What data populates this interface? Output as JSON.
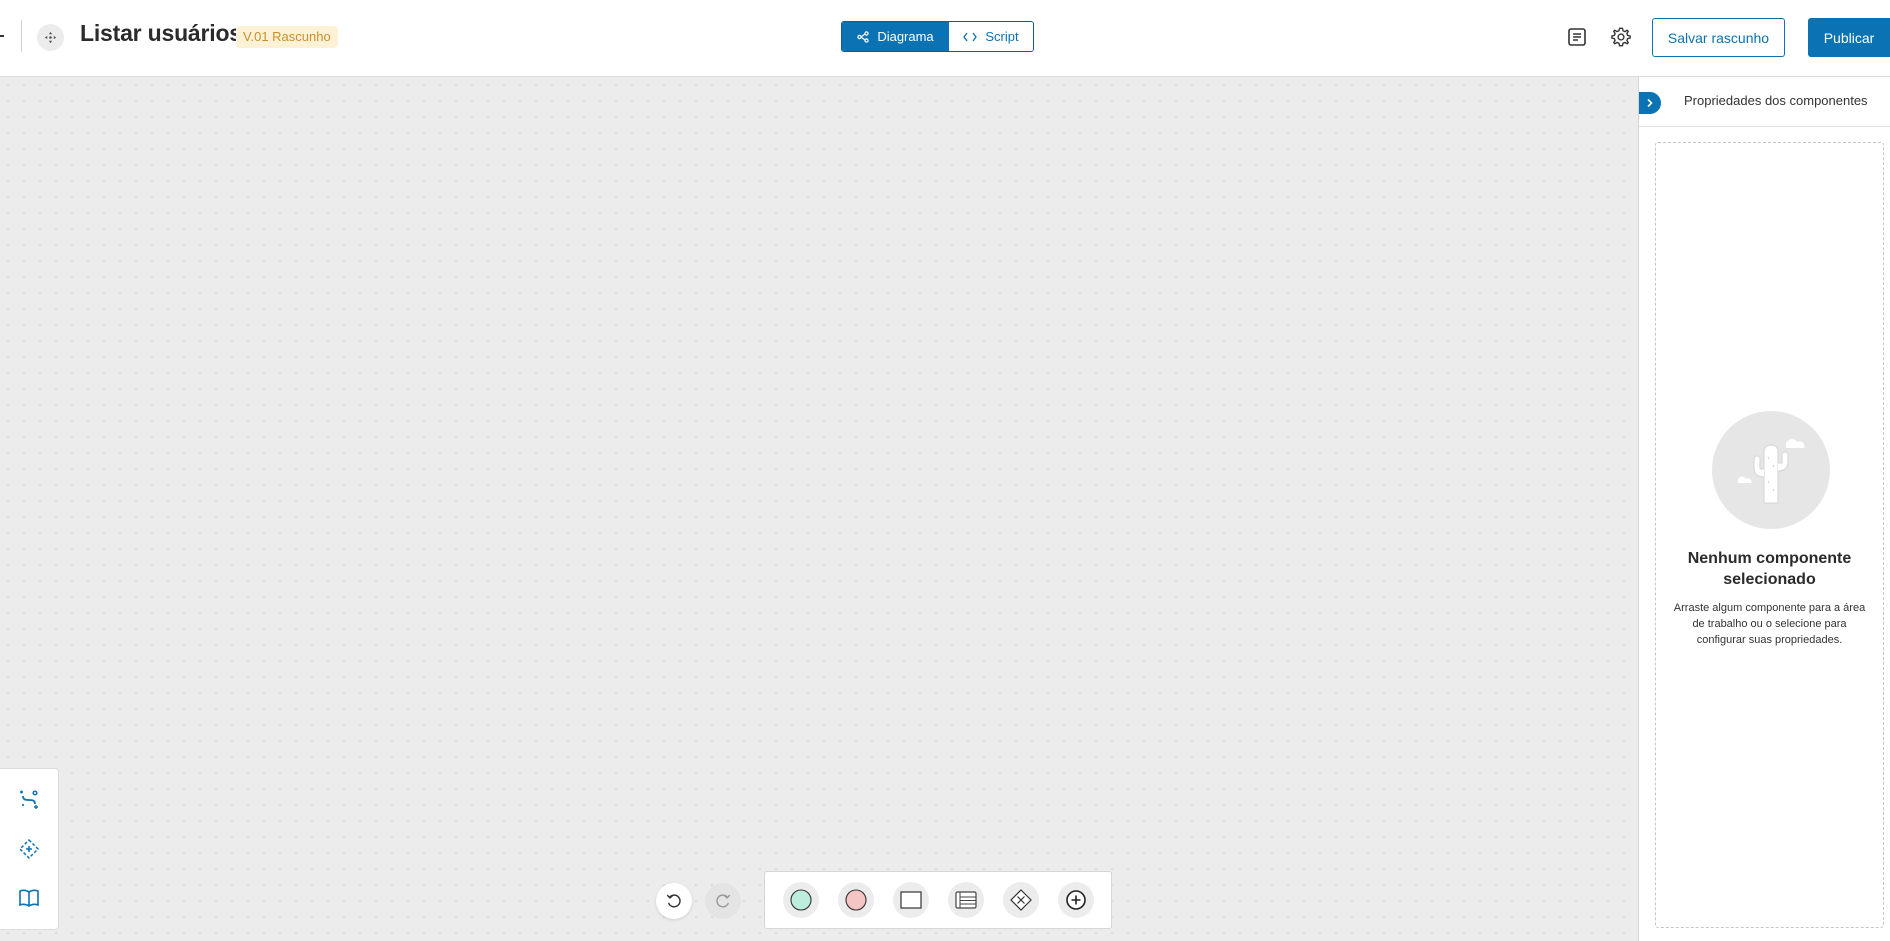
{
  "header": {
    "title": "Listar usuários",
    "version_badge": "V.01 Rascunho",
    "view_toggle": {
      "diagram_label": "Diagrama",
      "script_label": "Script",
      "selected": "Diagrama"
    },
    "save_draft_label": "Salvar rascunho",
    "publish_label": "Publicar",
    "icons": [
      "flow-icon",
      "document-list-icon",
      "gear-icon"
    ]
  },
  "canvas": {
    "background": "#ececec",
    "side_toolbar": [
      "auto-connect-icon",
      "recenter-icon",
      "book-icon"
    ],
    "history": [
      "undo-icon",
      "redo-icon"
    ],
    "palette": [
      "start-node-icon",
      "end-node-icon",
      "task-node-icon",
      "list-node-icon",
      "decision-node-icon",
      "add-node-icon"
    ]
  },
  "panel": {
    "title": "Propriedades dos componentes",
    "empty_title": "Nenhum componente selecionado",
    "empty_desc": "Arraste algum componente para a área de trabalho ou o selecione para configurar suas propriedades."
  },
  "colors": {
    "accent": "#0b73b3",
    "badge_bg": "#fdf1d6",
    "badge_text": "#c9902b",
    "start_node": "#bdeedd",
    "end_node": "#f5c4c4"
  }
}
